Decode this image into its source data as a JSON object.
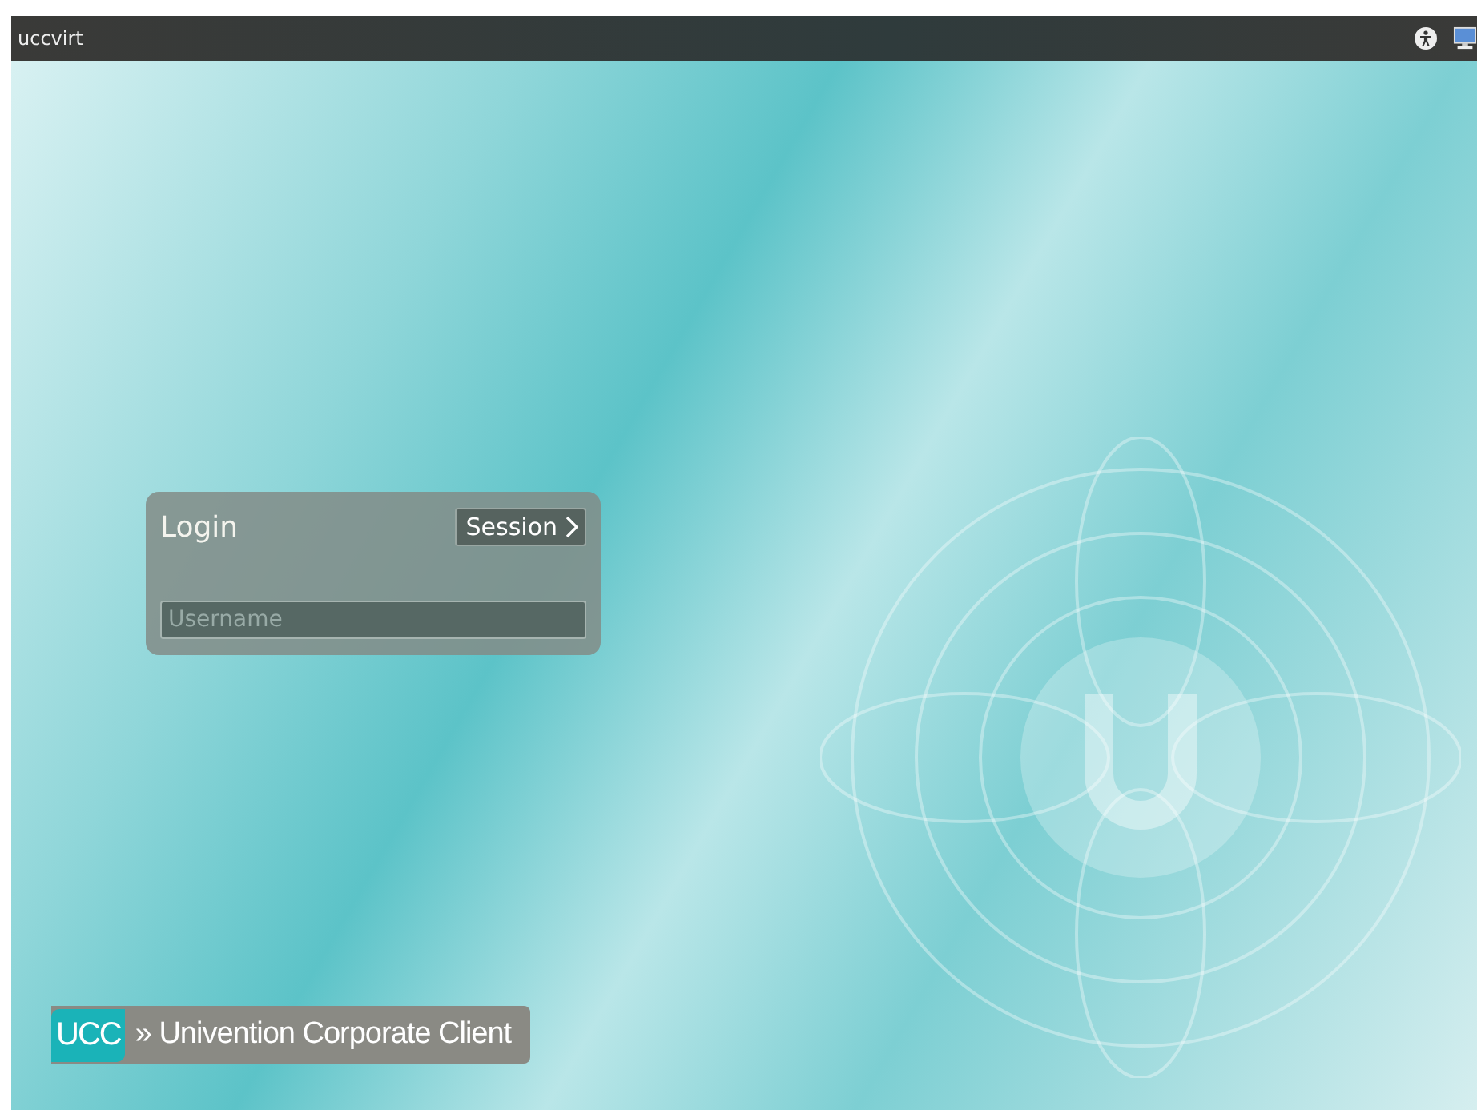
{
  "top_bar": {
    "hostname": "uccvirt"
  },
  "login": {
    "title": "Login",
    "session_button": "Session",
    "username": {
      "placeholder": "Username"
    }
  },
  "branding": {
    "badge": "UCC",
    "label": "» Univention Corporate Client"
  }
}
